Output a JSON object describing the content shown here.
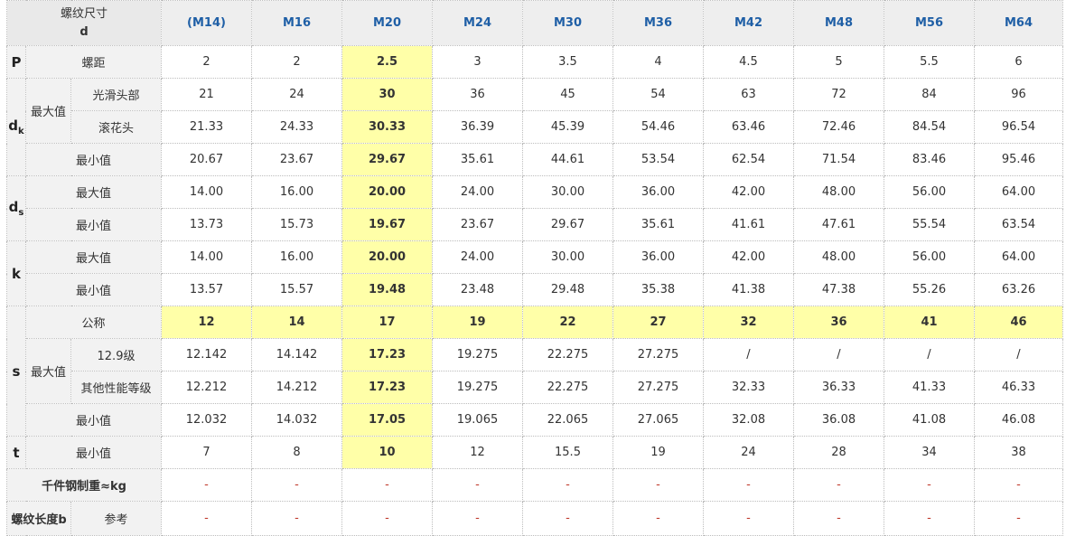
{
  "header": {
    "size_label": "螺纹尺寸",
    "size_symbol": "d",
    "columns": [
      "(M14)",
      "M16",
      "M20",
      "M24",
      "M30",
      "M36",
      "M42",
      "M48",
      "M56",
      "M64"
    ]
  },
  "rows": {
    "p": {
      "symbol": "P",
      "label": "螺距",
      "values": [
        "2",
        "2",
        "2.5",
        "3",
        "3.5",
        "4",
        "4.5",
        "5",
        "5.5",
        "6"
      ]
    },
    "dk": {
      "symbol": "d",
      "sub": "k",
      "max_label": "最大值",
      "smooth": {
        "label": "光滑头部",
        "values": [
          "21",
          "24",
          "30",
          "36",
          "45",
          "54",
          "63",
          "72",
          "84",
          "96"
        ]
      },
      "knurl": {
        "label": "滚花头",
        "values": [
          "21.33",
          "24.33",
          "30.33",
          "36.39",
          "45.39",
          "54.46",
          "63.46",
          "72.46",
          "84.54",
          "96.54"
        ]
      },
      "min": {
        "label": "最小值",
        "values": [
          "20.67",
          "23.67",
          "29.67",
          "35.61",
          "44.61",
          "53.54",
          "62.54",
          "71.54",
          "83.46",
          "95.46"
        ]
      }
    },
    "ds": {
      "symbol": "d",
      "sub": "s",
      "max": {
        "label": "最大值",
        "values": [
          "14.00",
          "16.00",
          "20.00",
          "24.00",
          "30.00",
          "36.00",
          "42.00",
          "48.00",
          "56.00",
          "64.00"
        ]
      },
      "min": {
        "label": "最小值",
        "values": [
          "13.73",
          "15.73",
          "19.67",
          "23.67",
          "29.67",
          "35.61",
          "41.61",
          "47.61",
          "55.54",
          "63.54"
        ]
      }
    },
    "k": {
      "symbol": "k",
      "max": {
        "label": "最大值",
        "values": [
          "14.00",
          "16.00",
          "20.00",
          "24.00",
          "30.00",
          "36.00",
          "42.00",
          "48.00",
          "56.00",
          "64.00"
        ]
      },
      "min": {
        "label": "最小值",
        "values": [
          "13.57",
          "15.57",
          "19.48",
          "23.48",
          "29.48",
          "35.38",
          "41.38",
          "47.38",
          "55.26",
          "63.26"
        ]
      }
    },
    "s": {
      "symbol": "s",
      "nominal": {
        "label": "公称",
        "values": [
          "12",
          "14",
          "17",
          "19",
          "22",
          "27",
          "32",
          "36",
          "41",
          "46"
        ]
      },
      "max_label": "最大值",
      "grade129": {
        "label": "12.9级",
        "values": [
          "12.142",
          "14.142",
          "17.23",
          "19.275",
          "22.275",
          "27.275",
          "/",
          "/",
          "/",
          "/"
        ]
      },
      "other": {
        "label": "其他性能等级",
        "values": [
          "12.212",
          "14.212",
          "17.23",
          "19.275",
          "22.275",
          "27.275",
          "32.33",
          "36.33",
          "41.33",
          "46.33"
        ]
      },
      "min": {
        "label": "最小值",
        "values": [
          "12.032",
          "14.032",
          "17.05",
          "19.065",
          "22.065",
          "27.065",
          "32.08",
          "36.08",
          "41.08",
          "46.08"
        ]
      }
    },
    "t": {
      "symbol": "t",
      "min": {
        "label": "最小值",
        "values": [
          "7",
          "8",
          "10",
          "12",
          "15.5",
          "19",
          "24",
          "28",
          "34",
          "38"
        ]
      }
    },
    "weight": {
      "label": "千件钢制重≈kg",
      "values": [
        "-",
        "-",
        "-",
        "-",
        "-",
        "-",
        "-",
        "-",
        "-",
        "-"
      ]
    },
    "thread_length": {
      "label": "螺纹长度b",
      "ref_label": "参考",
      "values": [
        "-",
        "-",
        "-",
        "-",
        "-",
        "-",
        "-",
        "-",
        "-",
        "-"
      ]
    }
  },
  "colors": {
    "highlight": "#ffffa8",
    "header_text": "#1f5fa6",
    "label_bg": "#f2f2f2",
    "dash": "#c0392b"
  }
}
